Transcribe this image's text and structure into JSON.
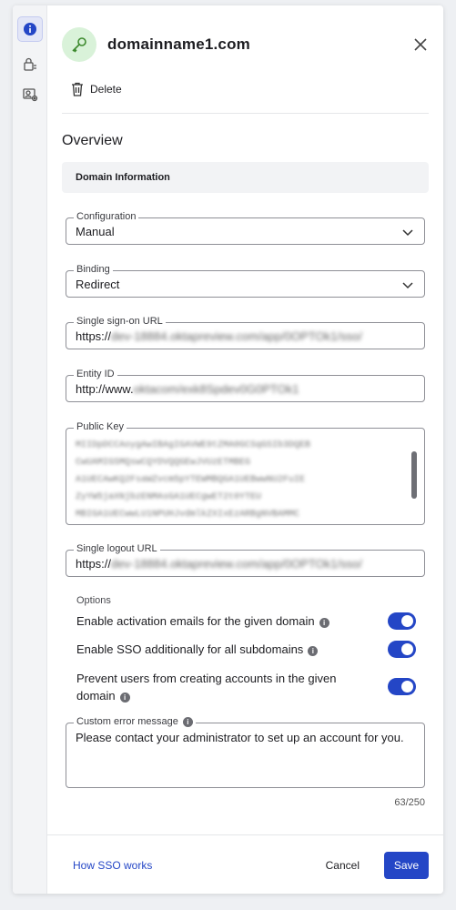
{
  "header": {
    "title": "domainname1.com",
    "delete_label": "Delete"
  },
  "overview_title": "Overview",
  "section_title": "Domain Information",
  "fields": {
    "configuration": {
      "label": "Configuration",
      "value": "Manual"
    },
    "binding": {
      "label": "Binding",
      "value": "Redirect"
    },
    "sso_url": {
      "label": "Single sign-on URL",
      "value_prefix": "https://",
      "value_blurred": "dev-18884.oktapreview.com/app/0OPTOk1/sso/"
    },
    "entity_id": {
      "label": "Entity ID",
      "value_prefix": "http://www.",
      "value_blurred": "oktacom/exk8Spdev0G0PTOk1"
    },
    "public_key": {
      "label": "Public Key",
      "lines": [
        "MIIDpDCCAoygAwIBAgIGAVWE9tZMA0GCSqGSIb3DQEB",
        "CwUAMIGSMQswCQYDVQQGEwJVUzETMBEG",
        "A1UECAwKQ2FsaWZvcm5pYTEWMBQGA1UEBwwNU2FuIE",
        "ZyYW5jaXNjbzENMAsGA1UECgwET2t0YTEU",
        "MBIGA1UECwwLU1NPUHJvdmlkZXIxEzARBgNVBAMMC"
      ]
    },
    "slo_url": {
      "label": "Single logout URL",
      "value_prefix": "https://",
      "value_blurred": "dev-18884.oktapreview.com/app/0OPTOk1/sso/"
    },
    "custom_error": {
      "label": "Custom error message",
      "value": "Please contact your administrator to set up an account for you.",
      "counter": "63/250"
    }
  },
  "options": {
    "title": "Options",
    "items": [
      {
        "label": "Enable  activation emails for the given domain",
        "enabled": true
      },
      {
        "label": "Enable SSO additionally for all subdomains",
        "enabled": true
      },
      {
        "label": "Prevent users from creating accounts in the given domain",
        "enabled": true
      }
    ]
  },
  "footer": {
    "help_link": "How SSO works",
    "cancel_label": "Cancel",
    "save_label": "Save"
  },
  "colors": {
    "accent": "#2446c6",
    "icon_bg": "#d9f2d9",
    "key_icon": "#3d8a2e"
  },
  "rail": {
    "icons": [
      "info-icon",
      "lock-list-icon",
      "user-settings-icon"
    ]
  }
}
